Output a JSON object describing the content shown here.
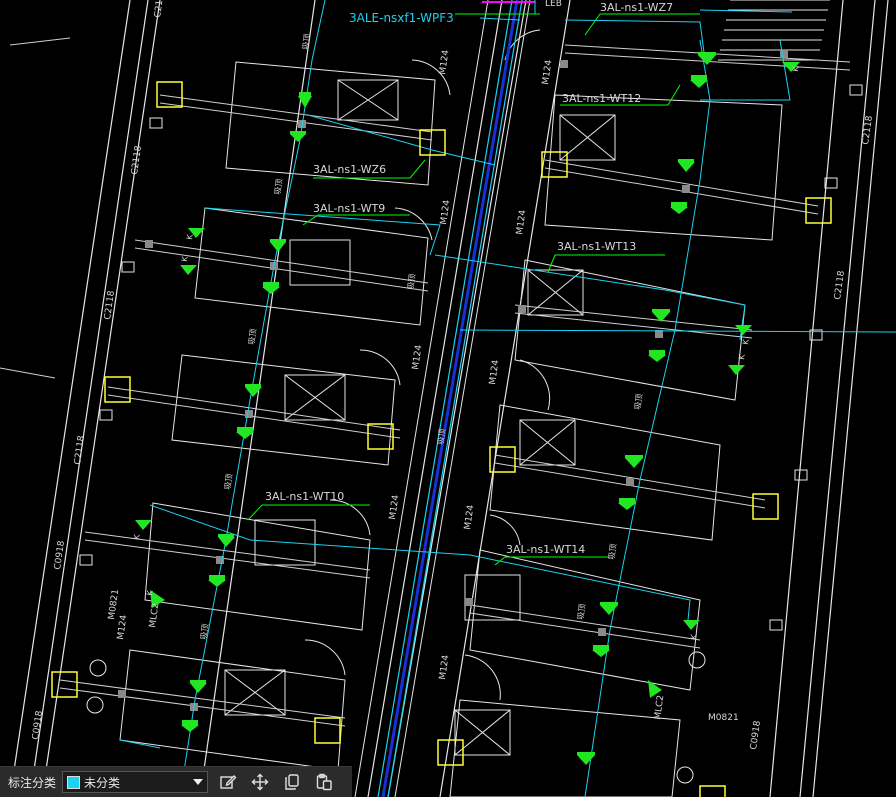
{
  "colors": {
    "background": "#000000",
    "wall": "#e6e6e6",
    "wire": "#19d3f0",
    "bus": "#1a2fd6",
    "label_line": "#00ff00",
    "fixture": "#22e622",
    "box": "#ffff33",
    "label_text": "#d8d8d8",
    "top_label": "#19d3f0",
    "magenta": "#ff00ff"
  },
  "drawing": {
    "top_wire_label": "3ALE-nsxf1-WPF3",
    "circuit_labels": [
      "3AL-ns1-WZ7",
      "3AL-ns1-WT12",
      "3AL-ns1-WZ6",
      "3AL-ns1-WT9",
      "3AL-ns1-WT13",
      "3AL-ns1-WT10",
      "3AL-ns1-WT14"
    ],
    "door_tags": [
      "M124",
      "M124",
      "M124",
      "M124",
      "M124",
      "M124",
      "M124",
      "M124",
      "M124",
      "M124",
      "M124",
      "M0821",
      "M0821",
      "MLC2",
      "MLC2"
    ],
    "window_tags": [
      "C2118",
      "C2118",
      "C2118",
      "C2118",
      "C2118",
      "C2118",
      "C0918",
      "C0918",
      "C0918"
    ],
    "partial_tag": "LEB",
    "small_tags": [
      "K",
      "K",
      "K",
      "K",
      "K",
      "K",
      "K",
      "K"
    ],
    "ceiling_tag": "吸顶"
  },
  "toolbar": {
    "label": "标注分类",
    "select_value": "未分类",
    "buttons": [
      "edit-icon",
      "move-icon",
      "copy-icon",
      "paste-icon"
    ]
  }
}
